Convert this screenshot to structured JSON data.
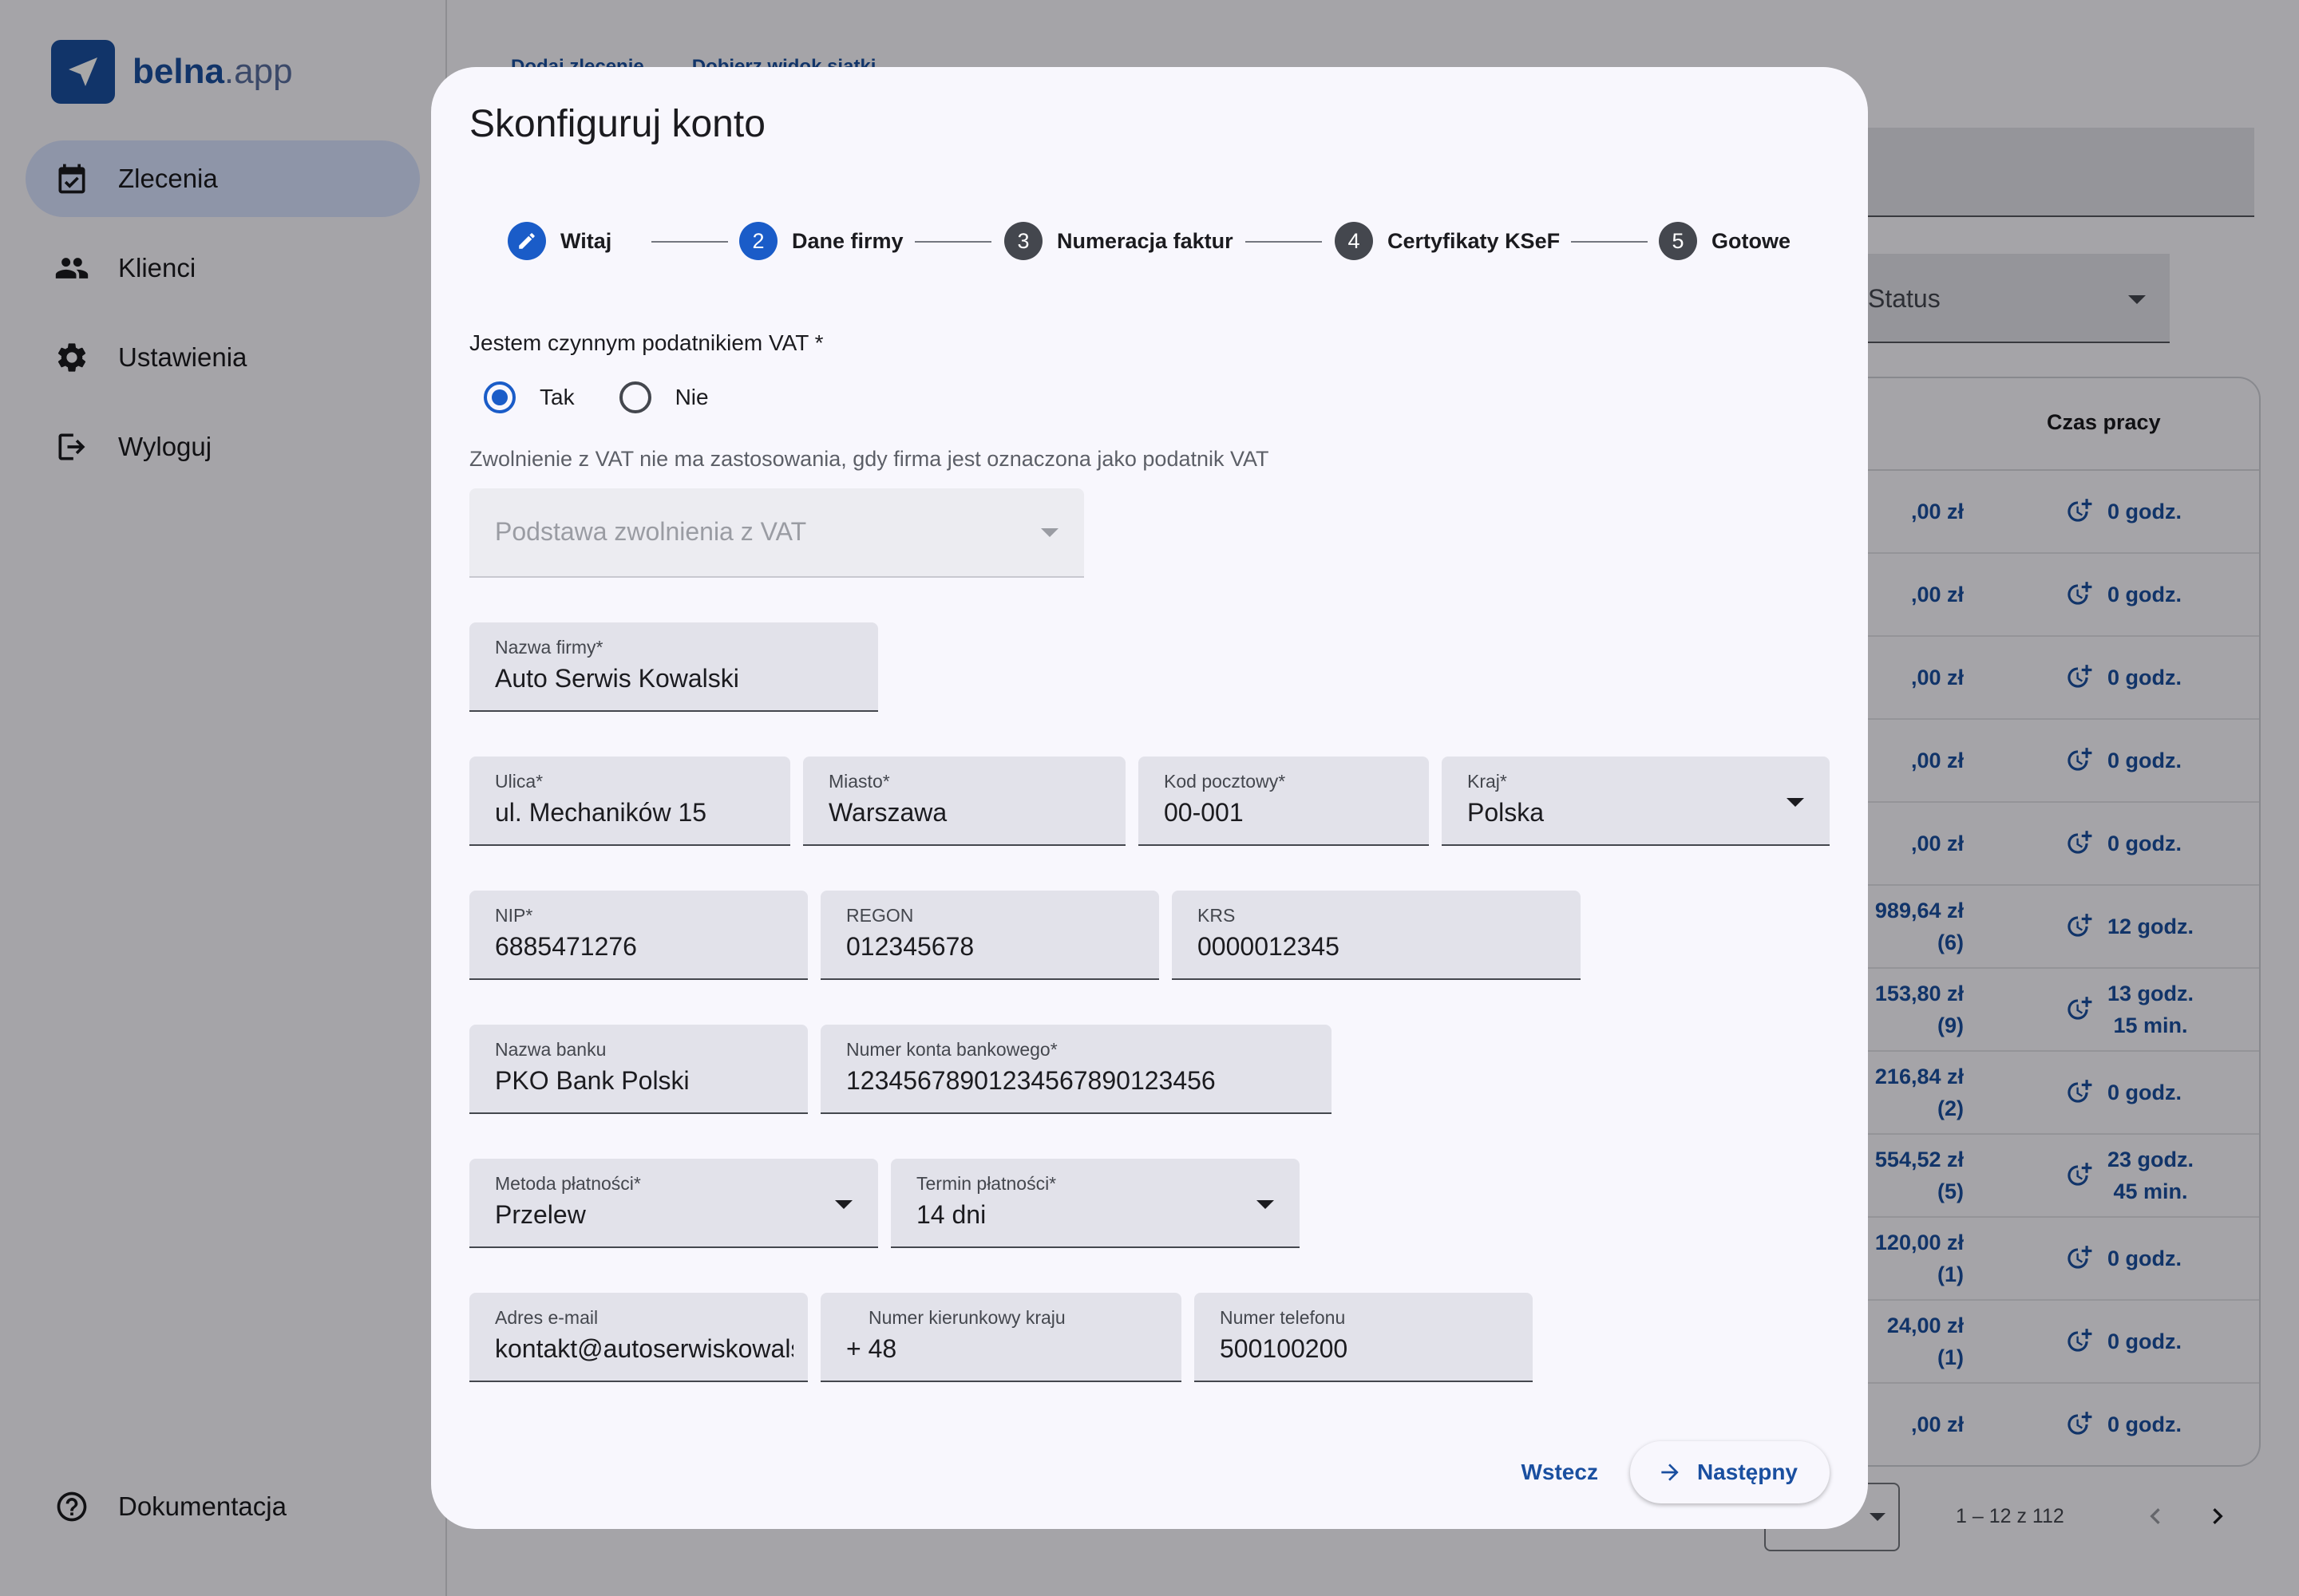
{
  "app": {
    "brand": {
      "name": "belna",
      "domain": ".app"
    },
    "nav": [
      {
        "label": "Zlecenia",
        "icon": "calendar-check-icon",
        "active": true
      },
      {
        "label": "Klienci",
        "icon": "people-icon",
        "active": false
      },
      {
        "label": "Ustawienia",
        "icon": "gear-icon",
        "active": false
      },
      {
        "label": "Wyloguj",
        "icon": "logout-icon",
        "active": false
      }
    ],
    "docs_label": "Dokumentacja",
    "toolbar": {
      "add_order": "Dodaj zlecenie",
      "view_columns": "Dobierz widok siatki"
    },
    "status_select": "Status",
    "table": {
      "header_time": "Czas pracy",
      "rows": [
        {
          "amount": ",00 zł",
          "count": "",
          "time": "0 godz.",
          "time2": ""
        },
        {
          "amount": ",00 zł",
          "count": "",
          "time": "0 godz.",
          "time2": ""
        },
        {
          "amount": ",00 zł",
          "count": "",
          "time": "0 godz.",
          "time2": ""
        },
        {
          "amount": ",00 zł",
          "count": "",
          "time": "0 godz.",
          "time2": ""
        },
        {
          "amount": ",00 zł",
          "count": "",
          "time": "0 godz.",
          "time2": ""
        },
        {
          "amount": "989,64 zł",
          "count": "(6)",
          "time": "12 godz.",
          "time2": ""
        },
        {
          "amount": "153,80 zł",
          "count": "(9)",
          "time": "13 godz.",
          "time2": "15 min."
        },
        {
          "amount": "216,84 zł",
          "count": "(2)",
          "time": "0 godz.",
          "time2": ""
        },
        {
          "amount": "554,52 zł",
          "count": "(5)",
          "time": "23 godz.",
          "time2": "45 min."
        },
        {
          "amount": "120,00 zł",
          "count": "(1)",
          "time": "0 godz.",
          "time2": ""
        },
        {
          "amount": "24,00 zł",
          "count": "(1)",
          "time": "0 godz.",
          "time2": ""
        },
        {
          "amount": ",00 zł",
          "count": "",
          "time": "0 godz.",
          "time2": ""
        }
      ]
    },
    "pagination": {
      "range": "1 – 12 z 112"
    }
  },
  "dialog": {
    "title": "Skonfiguruj konto",
    "steps": [
      {
        "num": "",
        "label": "Witaj",
        "state": "done"
      },
      {
        "num": "2",
        "label": "Dane firmy",
        "state": "active"
      },
      {
        "num": "3",
        "label": "Numeracja faktur",
        "state": "todo"
      },
      {
        "num": "4",
        "label": "Certyfikaty KSeF",
        "state": "todo"
      },
      {
        "num": "5",
        "label": "Gotowe",
        "state": "todo"
      }
    ],
    "vat_question": "Jestem czynnym podatnikiem VAT *",
    "vat_yes": "Tak",
    "vat_no": "Nie",
    "vat_selected": "Tak",
    "vat_hint": "Zwolnienie z VAT nie ma zastosowania, gdy firma jest oznaczona jako podatnik VAT",
    "vat_exemption_placeholder": "Podstawa zwolnienia z VAT",
    "fields": {
      "company_name": {
        "label": "Nazwa firmy*",
        "value": "Auto Serwis Kowalski"
      },
      "street": {
        "label": "Ulica*",
        "value": "ul. Mechaników 15"
      },
      "city": {
        "label": "Miasto*",
        "value": "Warszawa"
      },
      "postal": {
        "label": "Kod pocztowy*",
        "value": "00-001"
      },
      "country": {
        "label": "Kraj*",
        "value": "Polska"
      },
      "nip": {
        "label": "NIP*",
        "value": "6885471276"
      },
      "regon": {
        "label": "REGON",
        "value": "012345678"
      },
      "krs": {
        "label": "KRS",
        "value": "0000012345"
      },
      "bank_name": {
        "label": "Nazwa banku",
        "value": "PKO Bank Polski"
      },
      "bank_account": {
        "label": "Numer konta bankowego*",
        "value": "12345678901234567890123456"
      },
      "payment_method": {
        "label": "Metoda płatności*",
        "value": "Przelew"
      },
      "payment_term": {
        "label": "Termin płatności*",
        "value": "14 dni"
      },
      "email": {
        "label": "Adres e-mail",
        "value": "kontakt@autoserwiskowalski.pl"
      },
      "country_code": {
        "label": "Numer kierunkowy kraju",
        "value": "+ 48"
      },
      "phone": {
        "label": "Numer telefonu",
        "value": "500100200"
      }
    },
    "back_label": "Wstecz",
    "next_label": "Następny"
  },
  "colors": {
    "primary": "#1a5cc8",
    "brand": "#1a4fa0",
    "nav_active": "#d8e2ff"
  }
}
